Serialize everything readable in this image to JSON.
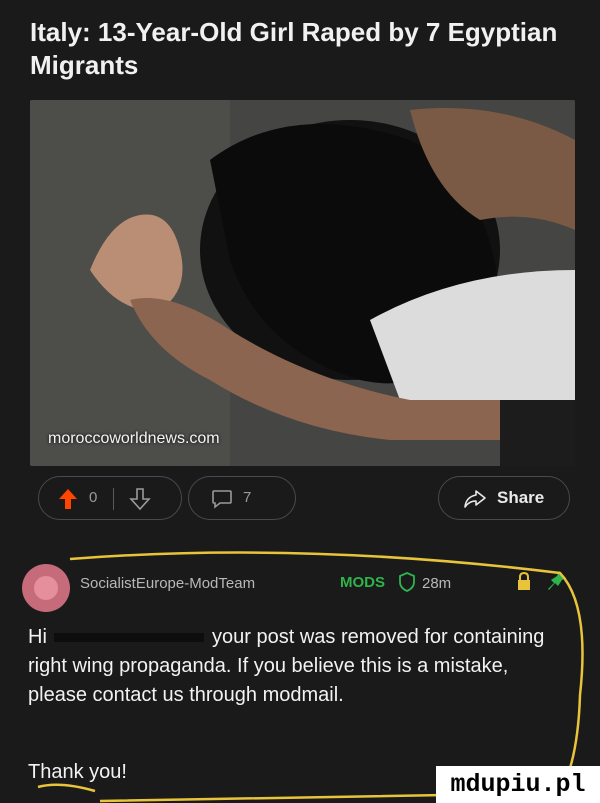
{
  "post": {
    "title": "Italy: 13-Year-Old Girl Raped by 7 Egyptian Migrants",
    "image_source": "moroccoworldnews.com",
    "votes": "0",
    "comments": "7",
    "share_label": "Share"
  },
  "comment": {
    "author": "SocialistEurope-ModTeam",
    "badge": "MODS",
    "time": "28m",
    "greeting": "Hi",
    "body": "your post was removed for containing right wing propaganda. If you believe this is a mistake, please contact us through modmail.",
    "signoff": "Thank you!"
  },
  "colors": {
    "background": "#1a1a1b",
    "mods_green": "#2fb34a",
    "upvote_red": "#ff4500",
    "annotation_yellow": "#e8c43a"
  },
  "icons": [
    "upvote-icon",
    "downvote-icon",
    "comment-icon",
    "share-icon",
    "shield-icon",
    "lock-icon",
    "pin-icon"
  ],
  "watermark": "mdupiu.pl"
}
